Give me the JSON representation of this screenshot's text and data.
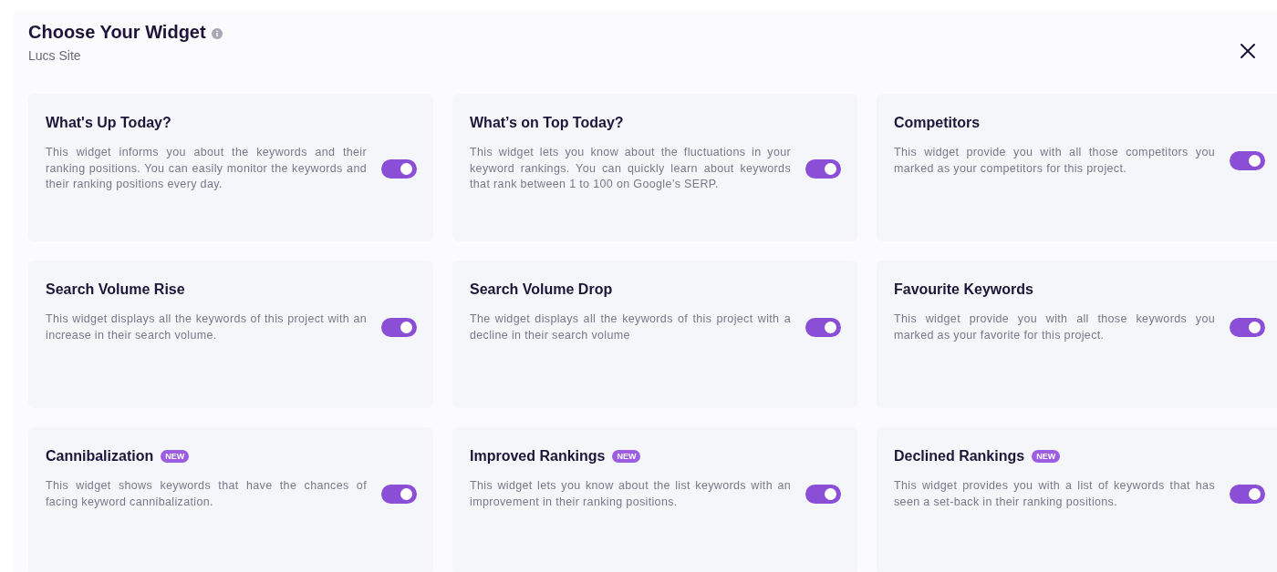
{
  "dialog": {
    "title": "Choose Your Widget",
    "subtitle": "Lucs Site"
  },
  "widgets": [
    {
      "title": "What's Up Today?",
      "description": "This widget informs you about the keywords and their ranking positions. You can easily monitor the keywords and their ranking positions every day.",
      "enabled": true
    },
    {
      "title": "What’s on Top Today?",
      "description": "This widget lets you know about the fluctuations in your keyword rankings. You can quickly learn about keywords that rank between 1 to 100 on Google’s SERP.",
      "enabled": true
    },
    {
      "title": "Competitors",
      "description": "This widget provide you with all those competitors you marked as your competitors for this project.",
      "enabled": true
    },
    {
      "title": "Search Volume Rise",
      "description": "This widget displays all the keywords of this project with an increase in their search volume.",
      "enabled": true
    },
    {
      "title": "Search Volume Drop",
      "description": "The widget displays all the keywords of this project with a decline in their search volume",
      "enabled": true
    },
    {
      "title": "Favourite Keywords",
      "description": "This widget provide you with all those keywords you marked as your favorite for this project.",
      "enabled": true
    },
    {
      "title": "Cannibalization",
      "badge": "NEW",
      "description": "This widget shows keywords that have the chances of facing keyword cannibalization.",
      "enabled": true
    },
    {
      "title": "Improved Rankings",
      "badge": "NEW",
      "description": "This widget lets you know about the list keywords with an improvement in their ranking positions.",
      "enabled": true
    },
    {
      "title": "Declined Rankings",
      "badge": "NEW",
      "description": "This widget provides you with a list of keywords that has seen a set-back in their ranking positions.",
      "enabled": true
    }
  ]
}
